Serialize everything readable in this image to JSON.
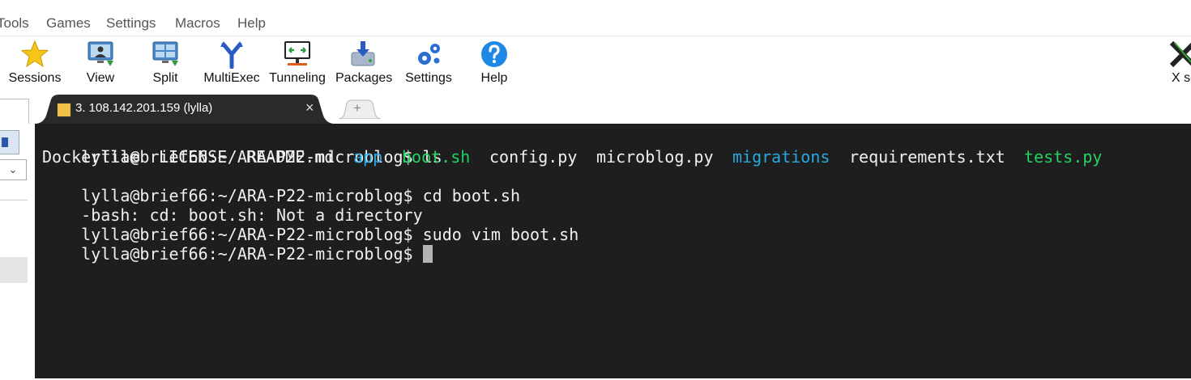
{
  "menu": [
    "Tools",
    "Games",
    "Settings",
    "Macros",
    "Help"
  ],
  "toolbar": [
    {
      "label": "Sessions",
      "icon": "star-icon"
    },
    {
      "label": "View",
      "icon": "monitor-user-icon"
    },
    {
      "label": "Split",
      "icon": "split-screen-icon"
    },
    {
      "label": "MultiExec",
      "icon": "fork-icon"
    },
    {
      "label": "Tunneling",
      "icon": "tunnel-monitor-icon"
    },
    {
      "label": "Packages",
      "icon": "package-download-icon"
    },
    {
      "label": "Settings",
      "icon": "gears-icon"
    },
    {
      "label": "Help",
      "icon": "question-icon"
    },
    {
      "label": "X se",
      "icon": "x-server-icon"
    }
  ],
  "tab": {
    "title": "3. 108.142.201.159 (lylla)",
    "close": "×",
    "new": "+"
  },
  "colors": {
    "terminal_bg": "#1e1e1e",
    "text": "#f0f0f0",
    "dir": "#29a8e0",
    "exec": "#23d160",
    "tab_bg": "#2a2a2a"
  },
  "terminal": {
    "lines": [
      [
        {
          "text": "lylla@brief66:~/ARA-P22-microblog$ ls",
          "color": "default"
        }
      ],
      [
        {
          "text": "Dockerfile",
          "color": "default"
        },
        {
          "text": "LICENSE",
          "color": "default"
        },
        {
          "text": "README.md",
          "color": "default"
        },
        {
          "text": "app",
          "color": "dir"
        },
        {
          "text": "boot.sh",
          "color": "exec"
        },
        {
          "text": "config.py",
          "color": "default"
        },
        {
          "text": "microblog.py",
          "color": "default"
        },
        {
          "text": "migrations",
          "color": "dir"
        },
        {
          "text": "requirements.txt",
          "color": "default"
        },
        {
          "text": "tests.py",
          "color": "exec"
        }
      ],
      [
        {
          "text": "lylla@brief66:~/ARA-P22-microblog$ cd boot.sh",
          "color": "default"
        }
      ],
      [
        {
          "text": "-bash: cd: boot.sh: Not a directory",
          "color": "default"
        }
      ],
      [
        {
          "text": "lylla@brief66:~/ARA-P22-microblog$ sudo vim boot.sh",
          "color": "default"
        }
      ],
      [
        {
          "text": "lylla@brief66:~/ARA-P22-microblog$ ",
          "color": "default",
          "cursor": true
        }
      ]
    ]
  }
}
